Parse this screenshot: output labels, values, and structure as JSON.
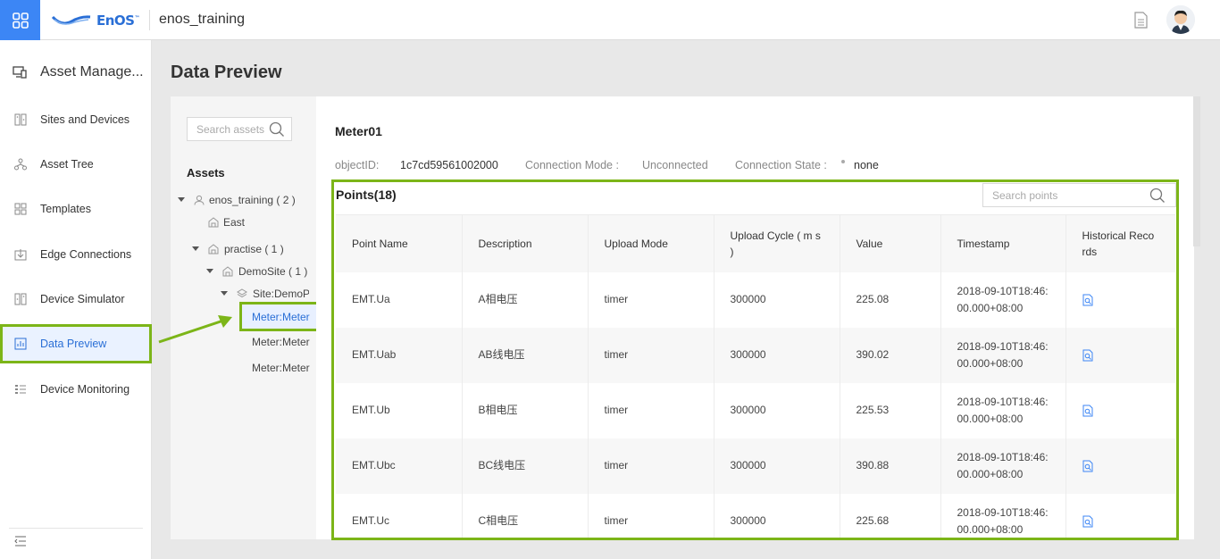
{
  "header": {
    "brand": "EnOS",
    "brand_mark": "™",
    "app_title": "enos_training"
  },
  "sidebar": {
    "section_title": "Asset Manage...",
    "items": [
      {
        "label": "Sites and Devices",
        "icon": "sites-icon"
      },
      {
        "label": "Asset Tree",
        "icon": "tree-icon"
      },
      {
        "label": "Templates",
        "icon": "templates-icon"
      },
      {
        "label": "Edge Connections",
        "icon": "edge-icon"
      },
      {
        "label": "Device Simulator",
        "icon": "simulator-icon"
      },
      {
        "label": "Data Preview",
        "icon": "chart-icon",
        "active": true
      },
      {
        "label": "Device Monitoring",
        "icon": "monitor-icon"
      }
    ]
  },
  "page": {
    "title": "Data Preview"
  },
  "tree": {
    "search_placeholder": "Search assets",
    "heading": "Assets",
    "nodes": [
      {
        "label": "enos_training ( 2 )"
      },
      {
        "label": "East"
      },
      {
        "label": "practise ( 1 )"
      },
      {
        "label": "DemoSite ( 1 )"
      },
      {
        "label": "Site:DemoPr"
      },
      {
        "label": "Meter:Meter"
      },
      {
        "label": "Meter:Meter"
      },
      {
        "label": "Meter:Meter"
      }
    ]
  },
  "device": {
    "name": "Meter01",
    "object_id_label": "objectID:",
    "object_id": "1c7cd59561002000",
    "conn_mode_label": "Connection Mode :",
    "conn_mode": "Unconnected",
    "conn_state_label": "Connection State :",
    "conn_state": "none"
  },
  "points": {
    "title": "Points(18)",
    "search_placeholder": "Search points",
    "columns": [
      "Point Name",
      "Description",
      "Upload Mode",
      "Upload Cycle ( m s )",
      "Value",
      "Timestamp",
      "Historical Reco rds"
    ],
    "rows": [
      {
        "name": "EMT.Ua",
        "desc": "A相电压",
        "mode": "timer",
        "cycle": "300000",
        "value": "225.08",
        "ts1": "2018-09-10T18:46:",
        "ts2": "00.000+08:00"
      },
      {
        "name": "EMT.Uab",
        "desc": "AB线电压",
        "mode": "timer",
        "cycle": "300000",
        "value": "390.02",
        "ts1": "2018-09-10T18:46:",
        "ts2": "00.000+08:00"
      },
      {
        "name": "EMT.Ub",
        "desc": "B相电压",
        "mode": "timer",
        "cycle": "300000",
        "value": "225.53",
        "ts1": "2018-09-10T18:46:",
        "ts2": "00.000+08:00"
      },
      {
        "name": "EMT.Ubc",
        "desc": "BC线电压",
        "mode": "timer",
        "cycle": "300000",
        "value": "390.88",
        "ts1": "2018-09-10T18:46:",
        "ts2": "00.000+08:00"
      },
      {
        "name": "EMT.Uc",
        "desc": "C相电压",
        "mode": "timer",
        "cycle": "300000",
        "value": "225.68",
        "ts1": "2018-09-10T18:46:",
        "ts2": "00.000+08:00"
      }
    ]
  },
  "colors": {
    "accent": "#3c86f5",
    "highlight": "#7cb518",
    "link": "#2a6fd6"
  }
}
